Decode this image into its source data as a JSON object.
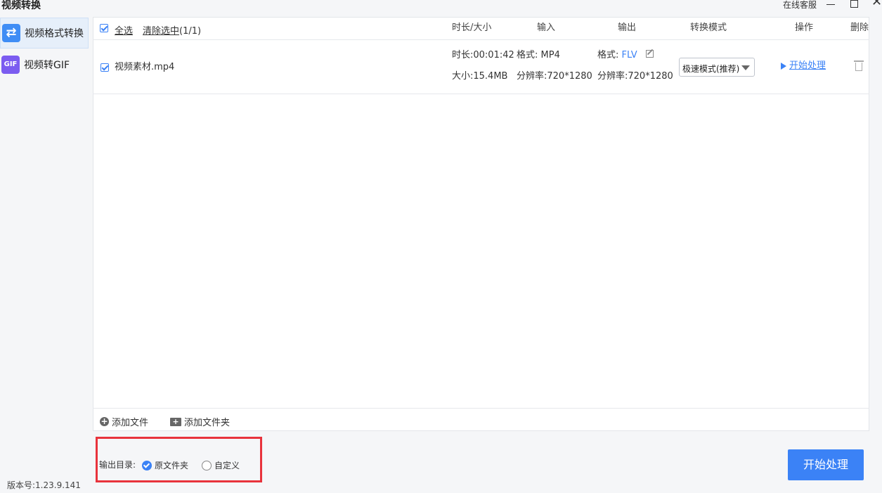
{
  "window": {
    "title": "视频转换",
    "online_service": "在线客服",
    "close_glyph": "✕"
  },
  "sidebar": {
    "items": [
      {
        "label": "视频格式转换",
        "icon": "convert-arrows-icon",
        "active": true
      },
      {
        "label": "视频转GIF",
        "icon": "gif-icon",
        "active": false
      }
    ],
    "version": "版本号:1.23.9.141"
  },
  "toolbar": {
    "select_all": "全选",
    "clear_selected": "清除选中",
    "selection_count": "(1/1)"
  },
  "columns": {
    "duration_size": "时长/大小",
    "input": "输入",
    "output": "输出",
    "mode": "转换模式",
    "action": "操作",
    "delete": "删除"
  },
  "files": [
    {
      "name": "视频素材.mp4",
      "checked": true,
      "duration": "时长:00:01:42",
      "size": "大小:15.4MB",
      "input_format": "格式: MP4",
      "input_resolution": "分辨率:720*1280",
      "output_format_label": "格式: ",
      "output_format": "FLV",
      "output_resolution": "分辨率:720*1280",
      "mode": "极速模式(推荐)",
      "action": "开始处理"
    }
  ],
  "footer": {
    "add_file": "添加文件",
    "add_folder": "添加文件夹"
  },
  "output_dir": {
    "label": "输出目录:",
    "options": [
      {
        "label": "原文件夹",
        "selected": true
      },
      {
        "label": "自定义",
        "selected": false
      }
    ]
  },
  "start_button": "开始处理",
  "colors": {
    "accent": "#3b82f6",
    "highlight_border": "#e8333c"
  }
}
